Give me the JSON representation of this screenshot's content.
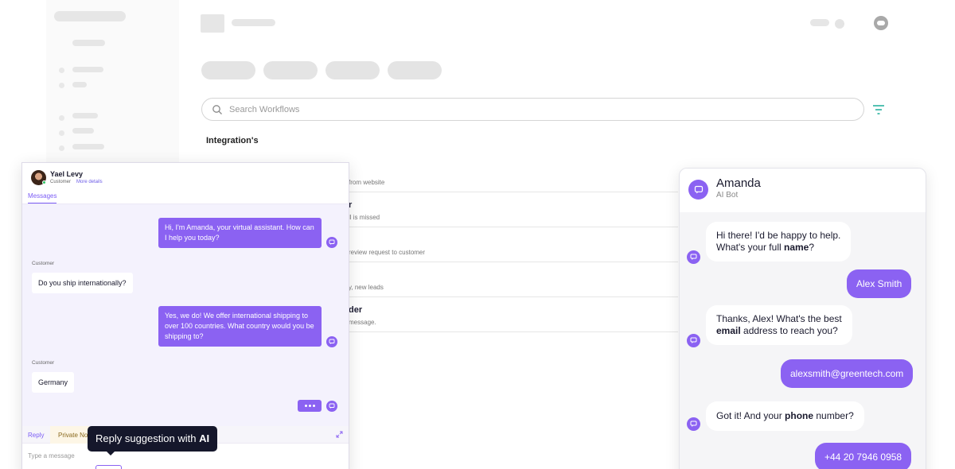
{
  "colors": {
    "accent": "#8b62f2",
    "tooltip_bg": "#15172b",
    "teal_filter": "#2bb3a0"
  },
  "workflows": {
    "search_placeholder": "Search Workflows",
    "section_title": "Integration's",
    "rows": [
      {
        "title": "",
        "desc": "from website"
      },
      {
        "title": "r",
        "desc": "ll is missed"
      },
      {
        "title": "",
        "desc": "review request to customer"
      },
      {
        "title": "",
        "desc": "y, new leads"
      },
      {
        "title": "der",
        "desc": "message."
      }
    ]
  },
  "left_chat": {
    "contact_name": "Yael Levy",
    "contact_role": "Customer",
    "more_details": "More details",
    "tab": "Messages",
    "messages": [
      {
        "from": "bot",
        "text": "Hi, I'm Amanda, your virtual assistant. How can I help you today?"
      },
      {
        "from": "customer",
        "label": "Customer",
        "text": "Do you ship internationally?"
      },
      {
        "from": "bot",
        "text": "Yes, we do! We offer international shipping to over 100 countries. What country would you be shipping to?"
      },
      {
        "from": "customer",
        "label": "Customer",
        "text": "Germany"
      }
    ],
    "compose": {
      "tab_reply": "Reply",
      "tab_private": "Private No",
      "placeholder": "Type a message"
    }
  },
  "tooltip": {
    "prefix": "Reply suggestion with ",
    "bold": "AI"
  },
  "right_chat": {
    "name": "Amanda",
    "subtitle": "AI Bot",
    "messages": [
      {
        "from": "bot",
        "line1": "Hi there! I'd be happy to help.",
        "line2_pre": "What's your full ",
        "line2_bold": "name",
        "line2_post": "?"
      },
      {
        "from": "user",
        "text": "Alex Smith"
      },
      {
        "from": "bot",
        "line1": "Thanks, Alex! What's the best",
        "line2_pre": "",
        "line2_bold": "email",
        "line2_post": " address to reach you?"
      },
      {
        "from": "user",
        "text": "alexsmith@greentech.com"
      },
      {
        "from": "bot",
        "line1": "",
        "line2_pre": "Got it! And your ",
        "line2_bold": "phone",
        "line2_post": " number?"
      },
      {
        "from": "user",
        "text": "+44 20 7946 0958"
      }
    ]
  }
}
